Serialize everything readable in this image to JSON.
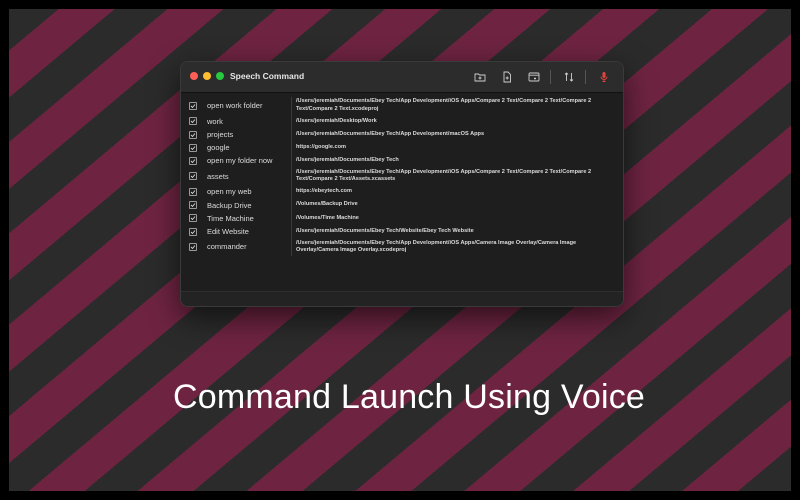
{
  "window": {
    "title": "Speech Command",
    "toolbar": {
      "buttons": [
        {
          "icon": "folder-add-icon"
        },
        {
          "icon": "file-add-icon"
        },
        {
          "icon": "browser-window-icon"
        },
        {
          "icon": "sort-arrows-icon"
        },
        {
          "icon": "microphone-icon"
        }
      ]
    }
  },
  "commands": [
    {
      "enabled": true,
      "name": "open work folder",
      "path": "/Users/jeremiah/Documents/Ebey Tech/App Development/iOS Apps/Compare 2 Text/Compare 2 Text/Compare 2 Text/Compare 2 Text.xcodeproj"
    },
    {
      "enabled": true,
      "name": "work",
      "path": "/Users/jeremiah/Desktop/Work"
    },
    {
      "enabled": true,
      "name": "projects",
      "path": "/Users/jeremiah/Documents/Ebey Tech/App Development/macOS Apps"
    },
    {
      "enabled": true,
      "name": "google",
      "path": "https://google.com"
    },
    {
      "enabled": true,
      "name": "open my folder now",
      "path": "/Users/jeremiah/Documents/Ebey Tech"
    },
    {
      "enabled": true,
      "name": "assets",
      "path": "/Users/jeremiah/Documents/Ebey Tech/App Development/iOS Apps/Compare 2 Text/Compare 2 Text/Compare 2 Text/Compare 2 Text/Assets.xcassets"
    },
    {
      "enabled": true,
      "name": "open my web",
      "path": "https://ebeytech.com"
    },
    {
      "enabled": true,
      "name": "Backup Drive",
      "path": "/Volumes/Backup Drive"
    },
    {
      "enabled": true,
      "name": "Time Machine",
      "path": "/Volumes/Time Machine"
    },
    {
      "enabled": true,
      "name": "Edit Website",
      "path": "/Users/jeremiah/Documents/Ebey Tech/Website/Ebey Tech Website"
    },
    {
      "enabled": true,
      "name": "commander",
      "path": "/Users/jeremiah/Documents/Ebey Tech/App Development/iOS Apps/Camera Image Overlay/Camera Image Overlay/Camera Image Overlay.xcodeproj"
    }
  ],
  "caption": "Command Launch Using Voice",
  "colors": {
    "stripe_dark": "#2b2b2b",
    "stripe_accent": "#6e2441",
    "mic_accent": "#e0443e"
  }
}
